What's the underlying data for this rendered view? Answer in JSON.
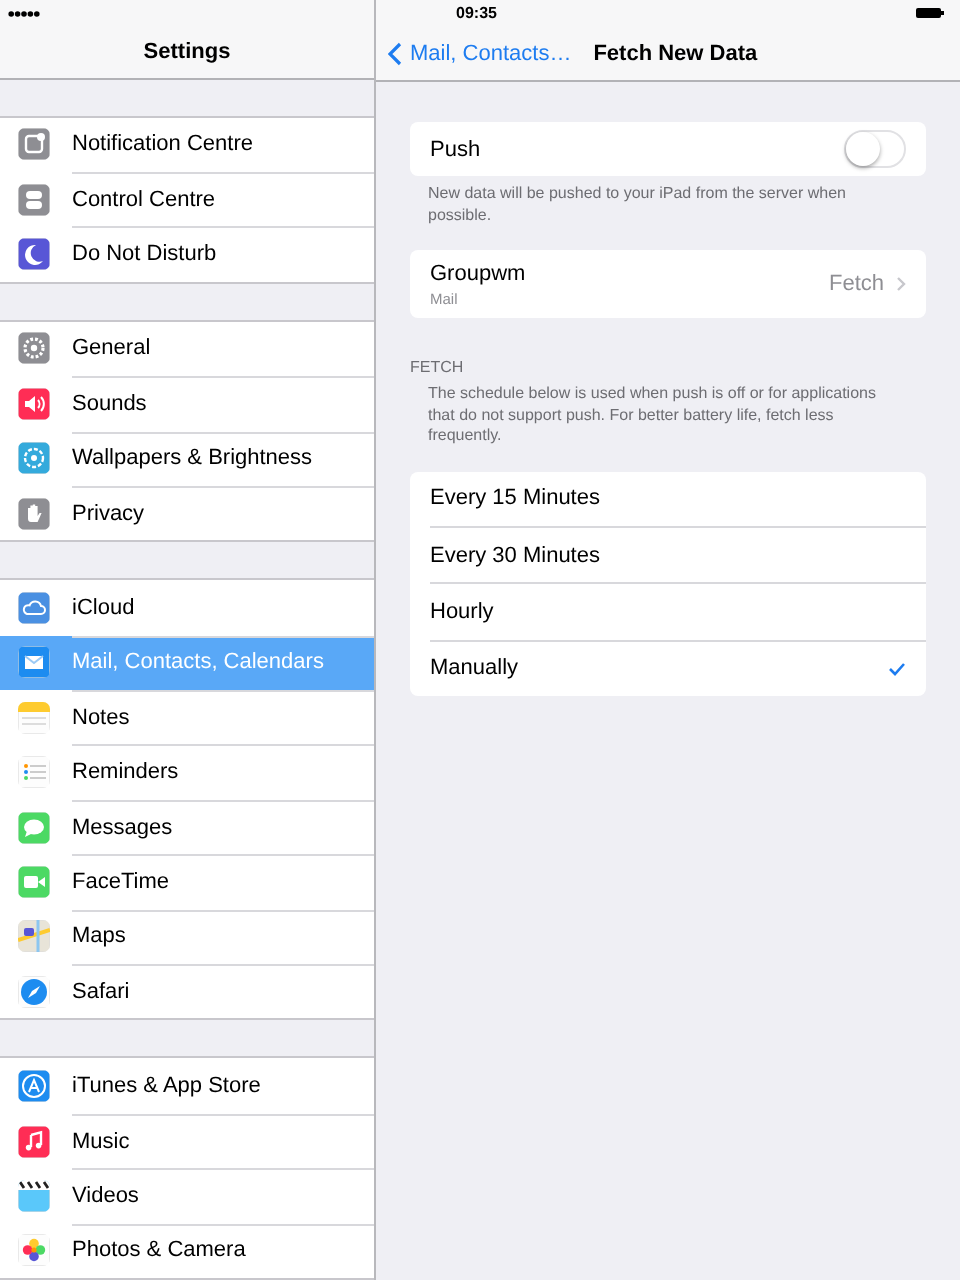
{
  "status_bar": {
    "time": "09:35"
  },
  "sidebar": {
    "title": "Settings",
    "groups": [
      [
        {
          "label": "Notification Centre",
          "selected": false
        },
        {
          "label": "Control Centre",
          "selected": false
        },
        {
          "label": "Do Not Disturb",
          "selected": false
        }
      ],
      [
        {
          "label": "General",
          "selected": false
        },
        {
          "label": "Sounds",
          "selected": false
        },
        {
          "label": "Wallpapers & Brightness",
          "selected": false
        },
        {
          "label": "Privacy",
          "selected": false
        }
      ],
      [
        {
          "label": "iCloud",
          "selected": false
        },
        {
          "label": "Mail, Contacts, Calendars",
          "selected": true
        },
        {
          "label": "Notes",
          "selected": false
        },
        {
          "label": "Reminders",
          "selected": false
        },
        {
          "label": "Messages",
          "selected": false
        },
        {
          "label": "FaceTime",
          "selected": false
        },
        {
          "label": "Maps",
          "selected": false
        },
        {
          "label": "Safari",
          "selected": false
        }
      ],
      [
        {
          "label": "iTunes & App Store",
          "selected": false
        },
        {
          "label": "Music",
          "selected": false
        },
        {
          "label": "Videos",
          "selected": false
        },
        {
          "label": "Photos & Camera",
          "selected": false
        }
      ]
    ]
  },
  "detail": {
    "back": "Mail, Contacts…",
    "title": "Fetch New Data",
    "push": {
      "label": "Push",
      "on": false,
      "footer": "New data will be pushed to your iPad from the server when possible."
    },
    "account": {
      "name": "Groupwm",
      "subtitle": "Mail",
      "value": "Fetch"
    },
    "fetch": {
      "header": "FETCH",
      "note": "The schedule below is used when push is off or for applications that do not support push. For better battery life, fetch less frequently.",
      "options": [
        {
          "label": "Every 15 Minutes",
          "selected": false
        },
        {
          "label": "Every 30 Minutes",
          "selected": false
        },
        {
          "label": "Hourly",
          "selected": false
        },
        {
          "label": "Manually",
          "selected": true
        }
      ]
    }
  }
}
